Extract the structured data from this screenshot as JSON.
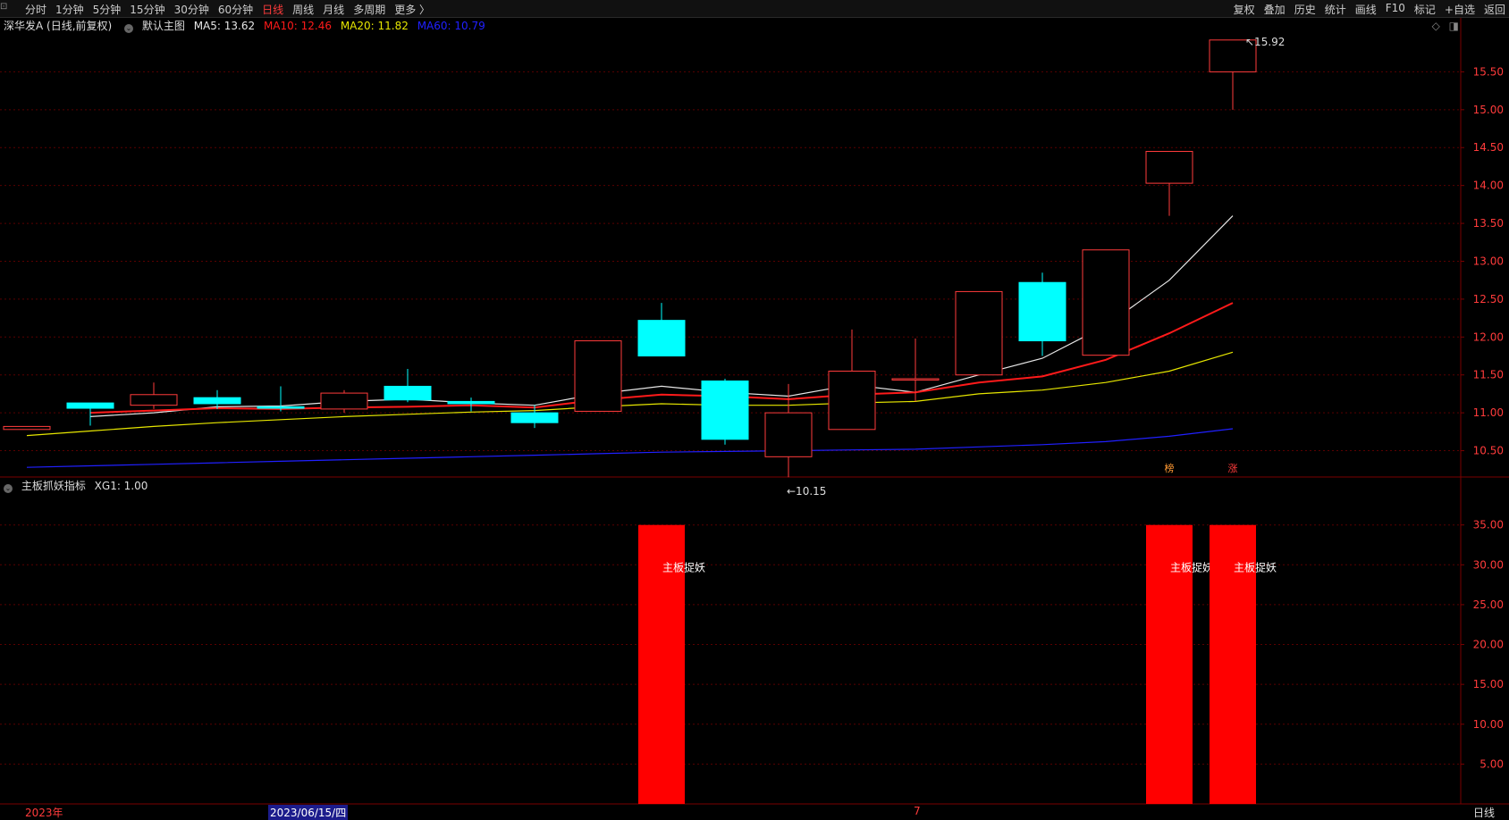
{
  "toolbar": {
    "left_items": [
      "分时",
      "1分钟",
      "5分钟",
      "15分钟",
      "30分钟",
      "60分钟",
      "日线",
      "周线",
      "月线",
      "多周期",
      "更多 〉"
    ],
    "active": "日线",
    "right_items": [
      "复权",
      "叠加",
      "历史",
      "统计",
      "画线",
      "F10",
      "标记",
      "+自选",
      "返回"
    ]
  },
  "main_legend": {
    "stock": "深华发A (日线,前复权)",
    "panel": "默认主图",
    "ma5": "MA5: 13.62",
    "ma10": "MA10: 12.46",
    "ma20": "MA20: 11.82",
    "ma60": "MA60: 10.79"
  },
  "indicator_legend": {
    "name": "主板抓妖指标",
    "value": "XG1: 1.00"
  },
  "annotations": {
    "high": "15.92",
    "low": "10.15",
    "tag1": "榜",
    "tag2": "涨"
  },
  "status": {
    "year": "2023年",
    "date": "2023/06/15/四",
    "month": "7",
    "period": "日线"
  },
  "colors": {
    "up": "#ff3b3b",
    "down": "#00ffff",
    "ma5": "#e6e6e6",
    "ma10": "#ff1a1a",
    "ma20": "#e6e600",
    "ma60": "#2020ff",
    "grid": "#5a0000",
    "bar": "#ff0000"
  },
  "chart_data": [
    {
      "type": "candlestick",
      "ylim": [
        10.2,
        16.0
      ],
      "yticks": [
        10.5,
        11.0,
        11.5,
        12.0,
        12.5,
        13.0,
        13.5,
        14.0,
        14.5,
        15.0,
        15.5
      ],
      "candles": [
        {
          "o": 10.78,
          "h": 10.82,
          "l": 10.78,
          "c": 10.82
        },
        {
          "o": 11.13,
          "h": 11.13,
          "l": 10.83,
          "c": 11.06
        },
        {
          "o": 11.1,
          "h": 11.4,
          "l": 11.05,
          "c": 11.24
        },
        {
          "o": 11.2,
          "h": 11.3,
          "l": 11.05,
          "c": 11.12
        },
        {
          "o": 11.08,
          "h": 11.35,
          "l": 11.02,
          "c": 11.06
        },
        {
          "o": 11.05,
          "h": 11.3,
          "l": 11.0,
          "c": 11.26
        },
        {
          "o": 11.35,
          "h": 11.58,
          "l": 11.14,
          "c": 11.17
        },
        {
          "o": 11.15,
          "h": 11.2,
          "l": 11.02,
          "c": 11.12
        },
        {
          "o": 11.0,
          "h": 11.1,
          "l": 10.8,
          "c": 10.87
        },
        {
          "o": 11.02,
          "h": 11.95,
          "l": 11.02,
          "c": 11.95
        },
        {
          "o": 12.22,
          "h": 12.45,
          "l": 11.75,
          "c": 11.75
        },
        {
          "o": 11.42,
          "h": 11.45,
          "l": 10.58,
          "c": 10.65
        },
        {
          "o": 10.42,
          "h": 11.38,
          "l": 10.15,
          "c": 11.0
        },
        {
          "o": 10.78,
          "h": 12.1,
          "l": 10.78,
          "c": 11.55
        },
        {
          "o": 11.45,
          "h": 11.98,
          "l": 11.15,
          "c": 11.45
        },
        {
          "o": 11.5,
          "h": 12.6,
          "l": 11.5,
          "c": 12.6
        },
        {
          "o": 12.72,
          "h": 12.85,
          "l": 11.75,
          "c": 11.95
        },
        {
          "o": 11.76,
          "h": 13.15,
          "l": 11.76,
          "c": 13.15
        },
        {
          "o": 14.03,
          "h": 14.45,
          "l": 13.6,
          "c": 14.45
        },
        {
          "o": 15.5,
          "h": 15.92,
          "l": 15.0,
          "c": 15.92
        }
      ],
      "series": [
        {
          "name": "MA5",
          "values": [
            null,
            10.95,
            11.0,
            11.08,
            11.09,
            11.15,
            11.18,
            11.13,
            11.1,
            11.25,
            11.35,
            11.27,
            11.22,
            11.37,
            11.27,
            11.5,
            11.72,
            12.15,
            12.75,
            13.6
          ]
        },
        {
          "name": "MA10",
          "values": [
            null,
            11.0,
            11.03,
            11.06,
            11.05,
            11.07,
            11.08,
            11.1,
            11.07,
            11.17,
            11.24,
            11.22,
            11.18,
            11.24,
            11.27,
            11.4,
            11.48,
            11.7,
            12.05,
            12.45
          ]
        },
        {
          "name": "MA20",
          "values": [
            10.7,
            10.76,
            10.82,
            10.87,
            10.91,
            10.95,
            10.98,
            11.01,
            11.03,
            11.08,
            11.12,
            11.1,
            11.1,
            11.13,
            11.15,
            11.25,
            11.3,
            11.4,
            11.55,
            11.8
          ]
        },
        {
          "name": "MA60",
          "values": [
            10.28,
            10.3,
            10.32,
            10.34,
            10.36,
            10.38,
            10.4,
            10.42,
            10.44,
            10.46,
            10.48,
            10.49,
            10.5,
            10.51,
            10.52,
            10.55,
            10.58,
            10.62,
            10.69,
            10.79
          ]
        }
      ]
    },
    {
      "type": "bar",
      "ylim": [
        0,
        39
      ],
      "yticks": [
        5.0,
        10.0,
        15.0,
        20.0,
        25.0,
        30.0,
        35.0
      ],
      "values": [
        0,
        0,
        0,
        0,
        0,
        0,
        0,
        0,
        0,
        0,
        35,
        0,
        0,
        0,
        0,
        0,
        0,
        0,
        35,
        35
      ],
      "labels": [
        "",
        "",
        "",
        "",
        "",
        "",
        "",
        "",
        "",
        "",
        "主板捉妖",
        "",
        "",
        "",
        "",
        "",
        "",
        "",
        "主板捉妖",
        "主板捉妖"
      ]
    }
  ]
}
